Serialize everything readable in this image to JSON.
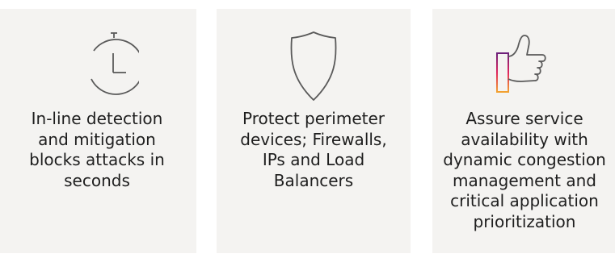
{
  "features": [
    {
      "icon": "stopwatch-icon",
      "lines": [
        "In-line detection",
        "and mitigation",
        "blocks attacks in",
        "seconds"
      ]
    },
    {
      "icon": "shield-icon",
      "lines": [
        "Protect perimeter",
        "devices; Firewalls,",
        "IPs and Load",
        "Balancers"
      ]
    },
    {
      "icon": "thumbs-up-icon",
      "lines": [
        "Assure service",
        "availability with",
        "dynamic congestion",
        "management and",
        "critical application",
        "prioritization"
      ]
    }
  ],
  "colors": {
    "card_background": "#f4f3f1",
    "icon_stroke": "#5a5a5a",
    "accent_gradient": [
      "#f2a230",
      "#e0245e",
      "#6b1f7a"
    ],
    "text": "#1e1e1e"
  }
}
